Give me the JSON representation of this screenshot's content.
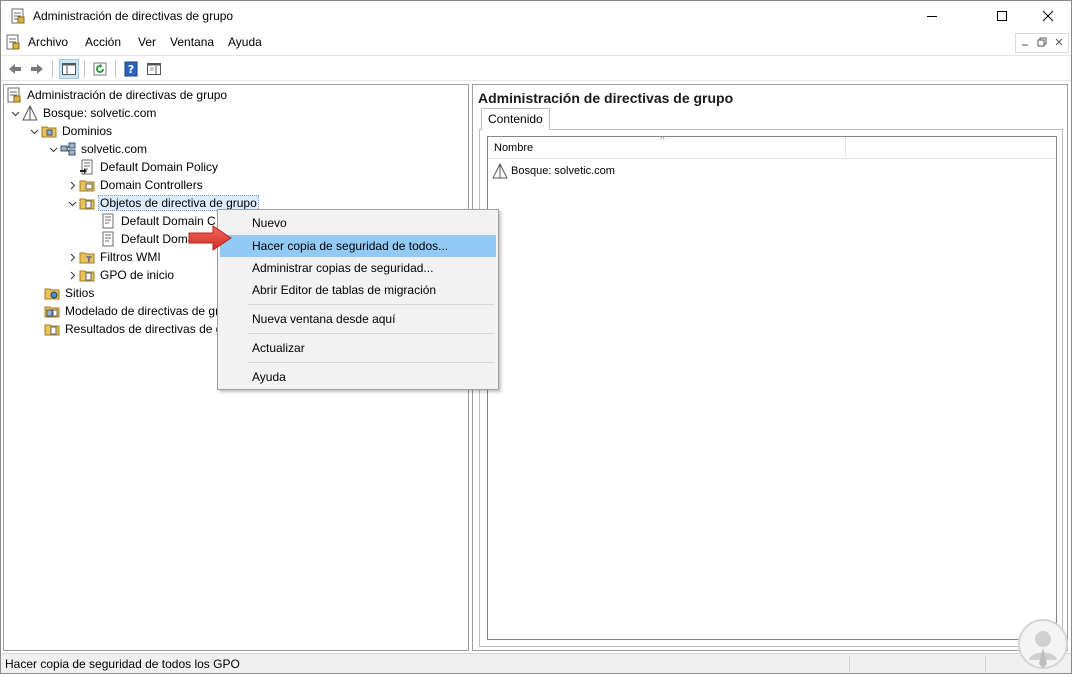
{
  "window": {
    "title": "Administración de directivas de grupo"
  },
  "menubar": {
    "items": [
      "Archivo",
      "Acción",
      "Ver",
      "Ventana",
      "Ayuda"
    ]
  },
  "toolbar": {
    "icons": [
      "back-icon",
      "forward-icon",
      "show-tree-icon",
      "refresh-icon",
      "help-icon",
      "show-action-pane-icon"
    ]
  },
  "tree": {
    "root": "Administración de directivas de grupo",
    "forest": "Bosque: solvetic.com",
    "domains": "Dominios",
    "domain": "solvetic.com",
    "ddp": "Default Domain Policy",
    "dc": "Domain Controllers",
    "gpo_objects": "Objetos de directiva de grupo",
    "gpo1": "Default Domain C",
    "gpo2": "Default Domain P",
    "wmi": "Filtros WMI",
    "starter": "GPO de inicio",
    "sites": "Sitios",
    "modeling": "Modelado de directivas de gru",
    "results": "Resultados de directivas de g"
  },
  "right_pane": {
    "title": "Administración de directivas de grupo",
    "tab": "Contenido",
    "column_name": "Nombre",
    "rows": [
      "Bosque: solvetic.com"
    ]
  },
  "context_menu": {
    "items": [
      "Nuevo",
      "Hacer copia de seguridad de todos...",
      "Administrar copias de seguridad...",
      "Abrir Editor de tablas de migración",
      "Nueva ventana desde aquí",
      "Actualizar",
      "Ayuda"
    ],
    "highlighted_index": 1
  },
  "statusbar": {
    "text": "Hacer copia de seguridad de todos los GPO"
  },
  "colors": {
    "highlight": "#91c9f7",
    "selection": "#dcecfc",
    "arrow": "#e8403a"
  }
}
